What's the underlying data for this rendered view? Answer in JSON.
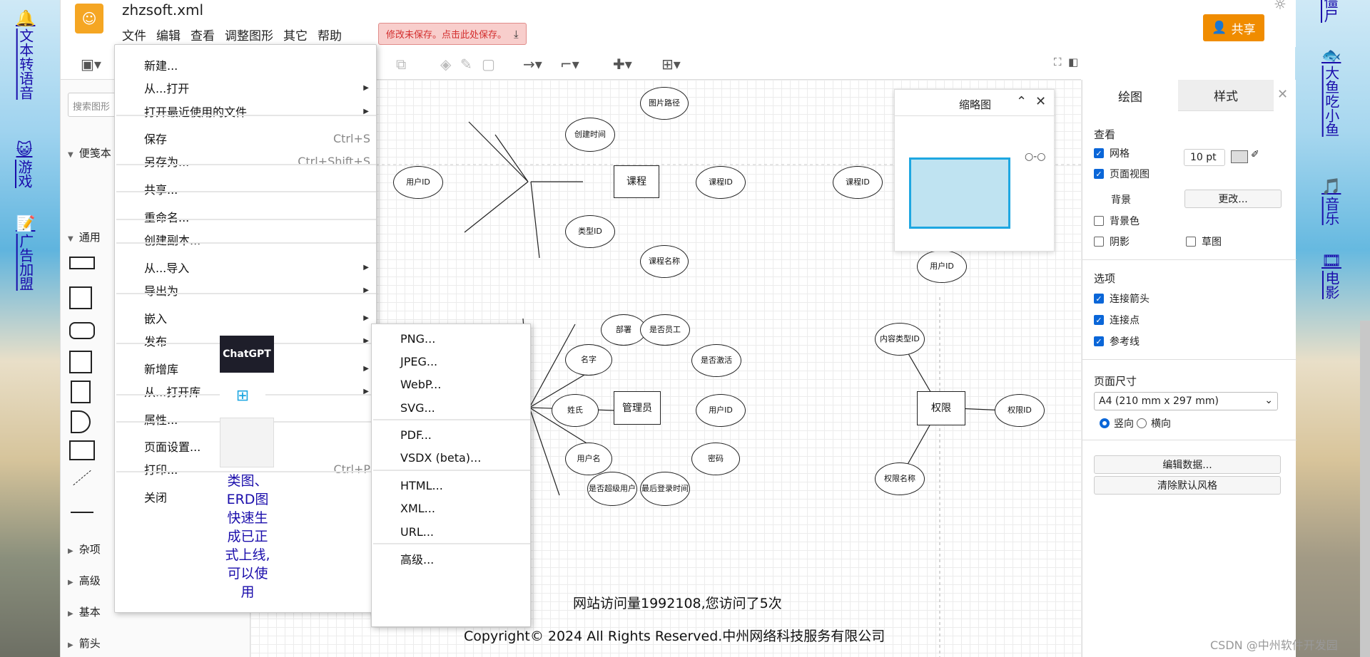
{
  "side_left": [
    {
      "icon": "🔔",
      "label": "文本转语音"
    },
    {
      "icon": "😺",
      "label": "游戏"
    },
    {
      "icon": "📝",
      "label": "广告加盟"
    }
  ],
  "side_right": [
    {
      "icon": "",
      "label": "僵尸"
    },
    {
      "icon": "🐟",
      "label": "大鱼吃小鱼"
    },
    {
      "icon": "🎵",
      "label": "音乐"
    },
    {
      "icon": "🎞",
      "label": "电影"
    }
  ],
  "app": {
    "title": "zhzsoft.xml",
    "menus": [
      "文件",
      "编辑",
      "查看",
      "调整图形",
      "其它",
      "帮助"
    ],
    "unsaved": "修改未保存。点击此处保存。",
    "share": "共享"
  },
  "left_panel": {
    "search_placeholder": "搜索图形",
    "sections": [
      "便笺本",
      "通用",
      "杂项",
      "高级",
      "基本",
      "箭头"
    ]
  },
  "file_menu": {
    "items": [
      {
        "label": "新建...",
        "shortcut": "",
        "submenu": false
      },
      {
        "label": "从...打开",
        "shortcut": "",
        "submenu": true
      },
      {
        "label": "打开最近使用的文件",
        "shortcut": "",
        "submenu": true
      },
      {
        "label": "保存",
        "shortcut": "Ctrl+S",
        "submenu": false
      },
      {
        "label": "另存为...",
        "shortcut": "Ctrl+Shift+S",
        "submenu": false
      },
      {
        "label": "共享...",
        "shortcut": "",
        "submenu": false
      },
      {
        "label": "重命名...",
        "shortcut": "",
        "submenu": false
      },
      {
        "label": "创建副本...",
        "shortcut": "",
        "submenu": false
      },
      {
        "label": "从...导入",
        "shortcut": "",
        "submenu": true
      },
      {
        "label": "导出为",
        "shortcut": "",
        "submenu": true
      },
      {
        "label": "嵌入",
        "shortcut": "",
        "submenu": true
      },
      {
        "label": "发布",
        "shortcut": "",
        "submenu": true
      },
      {
        "label": "新增库",
        "shortcut": "",
        "submenu": true
      },
      {
        "label": "从...打开库",
        "shortcut": "",
        "submenu": true
      },
      {
        "label": "属性...",
        "shortcut": "",
        "submenu": false
      },
      {
        "label": "页面设置...",
        "shortcut": "",
        "submenu": false
      },
      {
        "label": "打印...",
        "shortcut": "Ctrl+P",
        "submenu": false
      },
      {
        "label": "关闭",
        "shortcut": "",
        "submenu": false
      }
    ]
  },
  "export_submenu": [
    "PNG...",
    "JPEG...",
    "WebP...",
    "SVG...",
    "PDF...",
    "VSDX (beta)...",
    "HTML...",
    "XML...",
    "URL...",
    "高级..."
  ],
  "ad": {
    "chatgpt": "ChatGPT",
    "text": "类图、ERD图快速生成已正式上线,可以使用"
  },
  "diagram": {
    "course": {
      "label": "课程",
      "attrs": [
        "图片路径",
        "创建时间",
        "课程ID",
        "类型ID",
        "课程名称"
      ]
    },
    "admin": {
      "label": "管理员",
      "attrs": [
        "部署",
        "是否员工",
        "名字",
        "是否激活",
        "姓氏",
        "用户ID",
        "用户名",
        "密码",
        "是否超级用户",
        "最后登录时间"
      ]
    },
    "perm": {
      "label": "权限",
      "attrs": [
        "内容类型ID",
        "权限ID",
        "权限名称"
      ]
    },
    "other": [
      "用户ID",
      "课程ID",
      "用户ID"
    ]
  },
  "footer": {
    "visits": "网站访问量1992108,您访问了5次",
    "copyright": "Copyright© 2024 All Rights Reserved.中州网络科技服务有限公司"
  },
  "minimap": {
    "title": "缩略图"
  },
  "right_panel": {
    "tabs": [
      "绘图",
      "样式"
    ],
    "view_title": "查看",
    "grid": "网格",
    "grid_size": "10 pt",
    "page_view": "页面视图",
    "background": "背景",
    "change": "更改...",
    "bg_color": "背景色",
    "shadow": "阴影",
    "sketch": "草图",
    "options_title": "选项",
    "conn_arrows": "连接箭头",
    "conn_points": "连接点",
    "guides": "参考线",
    "page_size_title": "页面尺寸",
    "page_size": "A4 (210 mm x 297 mm)",
    "portrait": "竖向",
    "landscape": "横向",
    "edit_data": "编辑数据...",
    "clear_style": "清除默认风格"
  },
  "watermark": "CSDN @中州软件开发园"
}
